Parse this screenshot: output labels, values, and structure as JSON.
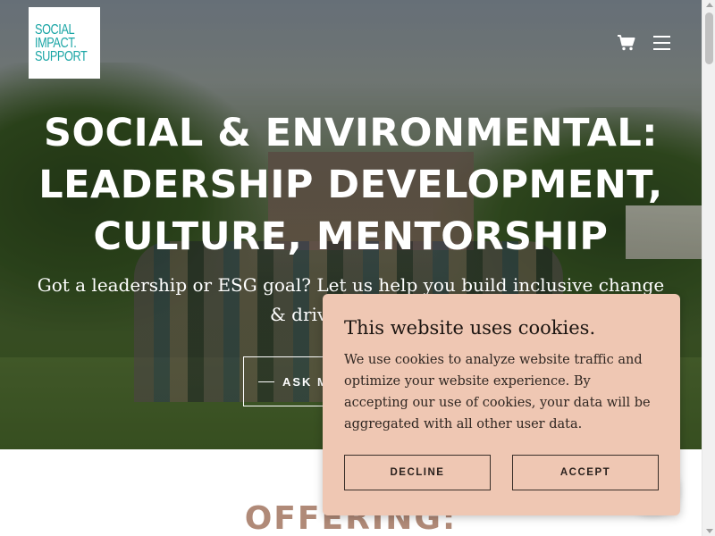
{
  "logo": {
    "lines": [
      "SOCIAL",
      "IMPACT.",
      "SUPPORT"
    ]
  },
  "header": {
    "cart_icon": "cart-icon",
    "menu_icon": "hamburger-menu-icon"
  },
  "hero": {
    "title_lines": [
      "SOCIAL & ENVIRONMENTAL:",
      "LEADERSHIP DEVELOPMENT,",
      "CULTURE, MENTORSHIP"
    ],
    "subtitle": "Got a leadership or ESG goal? Let us help you build inclusive change & drive resilience",
    "cta_label": "ASK M"
  },
  "section": {
    "offering_title": "OFFERING:"
  },
  "cookie_banner": {
    "title": "This website uses cookies.",
    "body": "We use cookies to analyze website traffic and optimize your website experience. By accepting our use of cookies, your data will be aggregated with all other user data.",
    "decline_label": "DECLINE",
    "accept_label": "ACCEPT"
  },
  "colors": {
    "logo_text": "#1aa5a5",
    "cookie_bg": "#efc7b3",
    "offering_heading": "#b08a78"
  }
}
